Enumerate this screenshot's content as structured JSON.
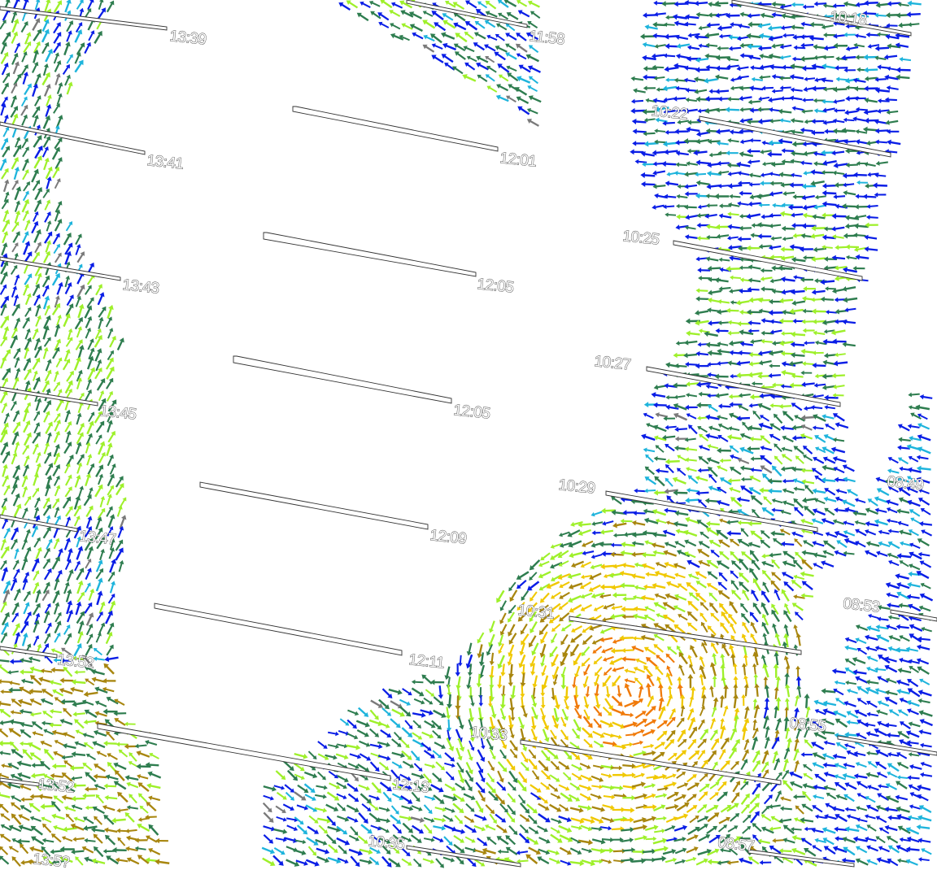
{
  "colors": {
    "background": "#ffffff",
    "arrow_blue": "#0a1ee6",
    "arrow_cyan": "#1eb4dc",
    "arrow_green": "#2e7d4f",
    "arrow_lime": "#9ef02a",
    "arrow_brown": "#a8860f",
    "arrow_yellow": "#f0c800",
    "arrow_orange": "#f07a0a",
    "arrow_gray": "#7a7a7a"
  },
  "swaths": {
    "left": [
      "13:39",
      "13:41",
      "13:43",
      "13:45",
      "13:47",
      "13:52",
      "13:52",
      "13:5?"
    ],
    "center": [
      "11:58",
      "12:01",
      "12:05",
      "12:05",
      "12:09",
      "12:11",
      "12:13"
    ],
    "right": [
      "10:18",
      "10:22",
      "10:25",
      "10:27",
      "10:29",
      "10:31",
      "10:33",
      "10:35"
    ],
    "far_right": [
      "08:49",
      "08:53",
      "08:55",
      "08:57"
    ]
  }
}
